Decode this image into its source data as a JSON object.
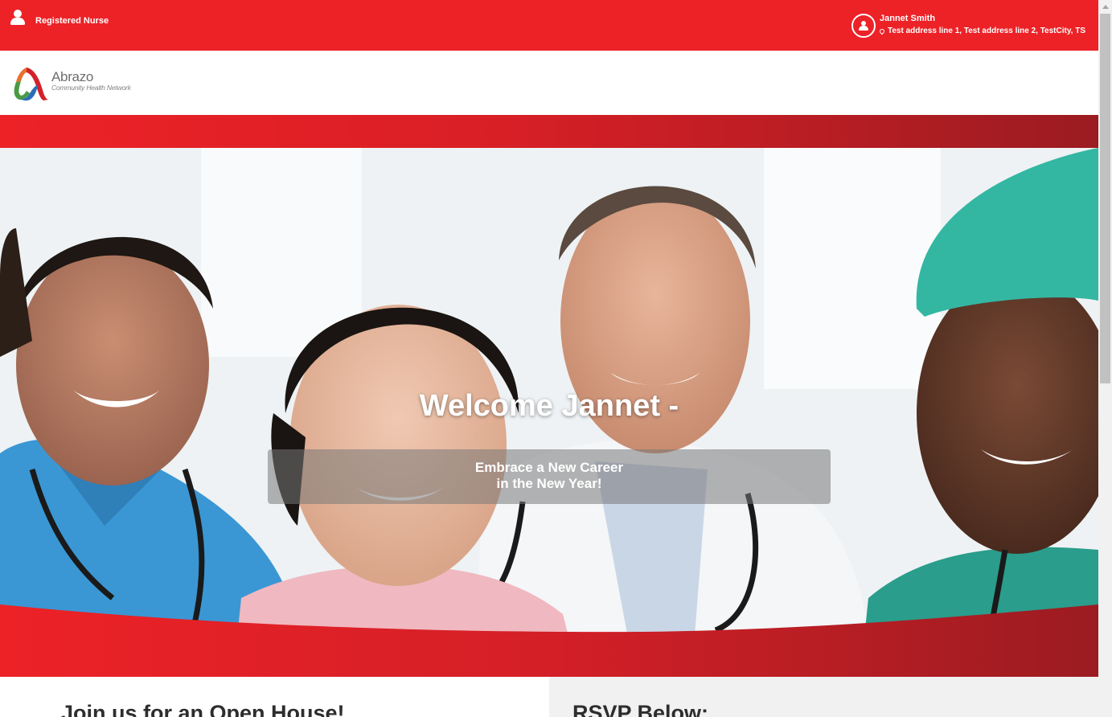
{
  "topbar": {
    "role": "Registered Nurse",
    "user_name": "Jannet Smith",
    "user_address": "Test address line 1, Test address line 2, TestCity, TS",
    "icons": {
      "role": "user-icon",
      "avatar": "user-circle-icon",
      "address": "map-marker-icon"
    }
  },
  "brand": {
    "name": "Abrazo",
    "tagline": "Community Health Network",
    "colors": {
      "red": "#ec2227",
      "dark_red": "#9b1c21",
      "green": "#4a9a44",
      "blue": "#2a6fb6"
    }
  },
  "hero": {
    "welcome": "Welcome Jannet -",
    "tagline_line1": "Embrace a New Career",
    "tagline_line2": "in the New Year!"
  },
  "sections": {
    "open_house_title": "Join us for an Open House!",
    "rsvp_title": "RSVP Below:"
  }
}
